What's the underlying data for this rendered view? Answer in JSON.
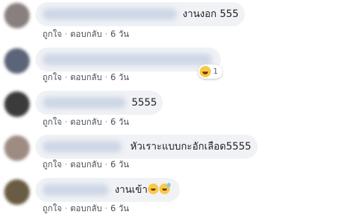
{
  "comments": [
    {
      "text": "งานงอก 555",
      "like": "ถูกใจ",
      "reply": "ตอบกลับ",
      "time": "6 วัน",
      "avatar_color": "#8a7f7f"
    },
    {
      "text": "",
      "like": "ถูกใจ",
      "reply": "ตอบกลับ",
      "time": "6 วัน",
      "avatar_color": "#5b6478",
      "reaction_count": "1",
      "reaction_icon": "laugh-emoji-icon"
    },
    {
      "text": "5555",
      "like": "ถูกใจ",
      "reply": "ตอบกลับ",
      "time": "6 วัน",
      "avatar_color": "#3b3b3b"
    },
    {
      "text": "หัวเราะแบบกะอักเลือด5555",
      "like": "ถูกใจ",
      "reply": "ตอบกลับ",
      "time": "6 วัน",
      "avatar_color": "#9e8c82"
    },
    {
      "text": "งานเข้า",
      "like": "ถูกใจ",
      "reply": "ตอบกลับ",
      "time": "6 วัน",
      "avatar_color": "#6a5c44",
      "emojis": [
        "grinning-face-icon",
        "grinning-sweat-face-icon"
      ]
    }
  ],
  "separator": "·"
}
